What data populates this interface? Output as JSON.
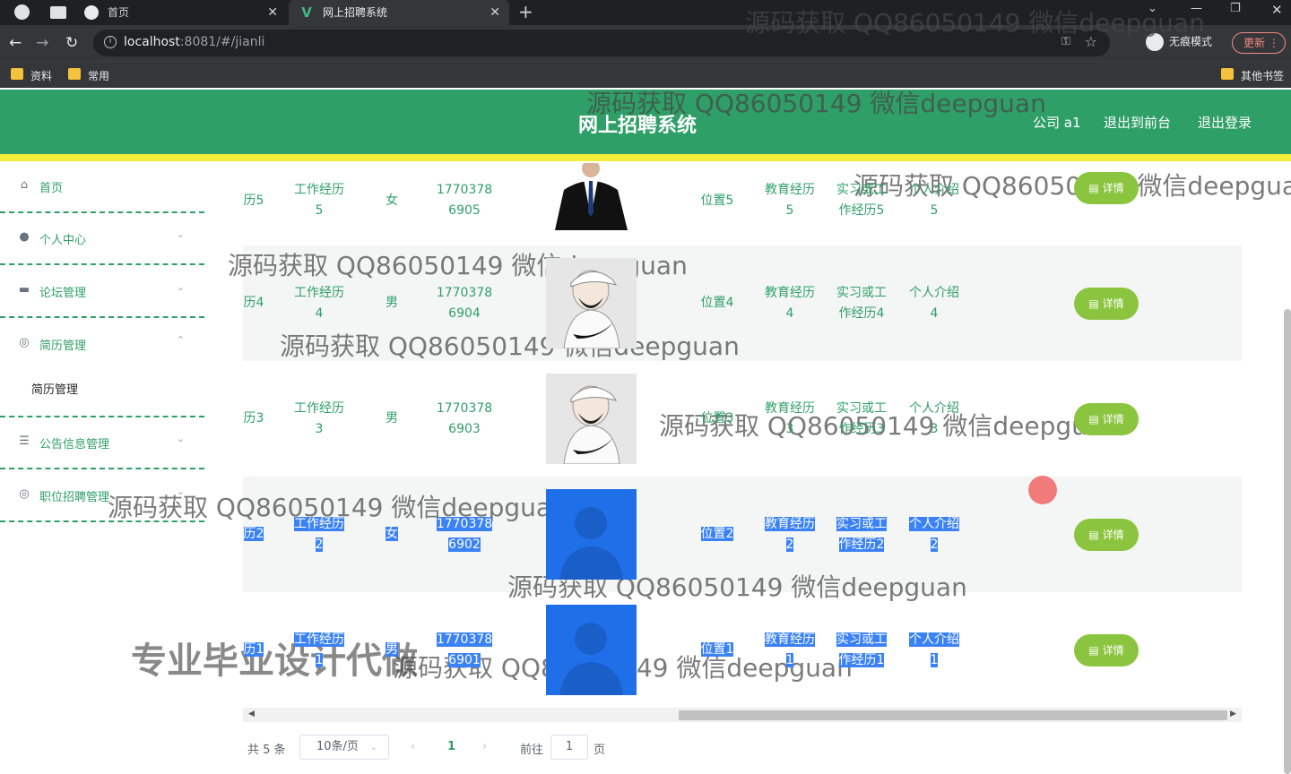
{
  "browser": {
    "tabs": [
      {
        "label": "首页"
      },
      {
        "label": "网上招聘系统"
      }
    ],
    "url_host": "localhost",
    "url_rest": ":8081/#/jianli",
    "incognito_label": "无痕模式",
    "update_label": "更新",
    "bookmarks": [
      "资料",
      "常用"
    ],
    "other_bookmarks": "其他书签"
  },
  "header": {
    "title": "网上招聘系统",
    "links": [
      "公司 a1",
      "退出到前台",
      "退出登录"
    ]
  },
  "sidebar": {
    "items": [
      {
        "label": "首页",
        "icon": "home-icon"
      },
      {
        "label": "个人中心",
        "icon": "user-icon"
      },
      {
        "label": "论坛管理",
        "icon": "forum-icon"
      },
      {
        "label": "简历管理",
        "icon": "resume-icon"
      },
      {
        "label": "公告信息管理",
        "icon": "list-icon"
      },
      {
        "label": "职位招聘管理",
        "icon": "job-icon"
      }
    ],
    "sub_item": "简历管理"
  },
  "table": {
    "rows": [
      {
        "name": "历5",
        "exp": [
          "工作经历",
          "5"
        ],
        "gender": "女",
        "phone": [
          "1770378",
          "6905"
        ],
        "position": "位置5",
        "edu": [
          "教育经历",
          "5"
        ],
        "intern": [
          "实习或工",
          "作经历5"
        ],
        "intro": [
          "个人介绍",
          "5"
        ],
        "photo": "suit",
        "selected": false
      },
      {
        "name": "历4",
        "exp": [
          "工作经历",
          "4"
        ],
        "gender": "男",
        "phone": [
          "1770378",
          "6904"
        ],
        "position": "位置4",
        "edu": [
          "教育经历",
          "4"
        ],
        "intern": [
          "实习或工",
          "作经历4"
        ],
        "intro": [
          "个人介绍",
          "4"
        ],
        "photo": "cap",
        "selected": false
      },
      {
        "name": "历3",
        "exp": [
          "工作经历",
          "3"
        ],
        "gender": "男",
        "phone": [
          "1770378",
          "6903"
        ],
        "position": "位置3",
        "edu": [
          "教育经历",
          "3"
        ],
        "intern": [
          "实习或工",
          "作经历3"
        ],
        "intro": [
          "个人介绍",
          "3"
        ],
        "photo": "cap",
        "selected": false
      },
      {
        "name": "历2",
        "exp": [
          "工作经历",
          "2"
        ],
        "gender": "女",
        "phone": [
          "1770378",
          "6902"
        ],
        "position": "位置2",
        "edu": [
          "教育经历",
          "2"
        ],
        "intern": [
          "实习或工",
          "作经历2"
        ],
        "intro": [
          "个人介绍",
          "2"
        ],
        "photo": "blue",
        "selected": true
      },
      {
        "name": "历1",
        "exp": [
          "工作经历",
          "1"
        ],
        "gender": "男",
        "phone": [
          "1770378",
          "6901"
        ],
        "position": "位置1",
        "edu": [
          "教育经历",
          "1"
        ],
        "intern": [
          "实习或工",
          "作经历1"
        ],
        "intro": [
          "个人介绍",
          "1"
        ],
        "photo": "blue",
        "selected": true
      }
    ],
    "detail_label": "详情"
  },
  "pager": {
    "total": "共 5 条",
    "page_size": "10条/页",
    "current_page": "1",
    "goto_prefix": "前往",
    "goto_value": "1",
    "goto_suffix": "页"
  },
  "watermark_text": "源码获取 QQ86050149 微信deepguan",
  "promo_text": "专业毕业设计代做",
  "colors": {
    "header": "#2f9f68",
    "stripe": "#f4ee3a",
    "button": "#8bc53f"
  }
}
